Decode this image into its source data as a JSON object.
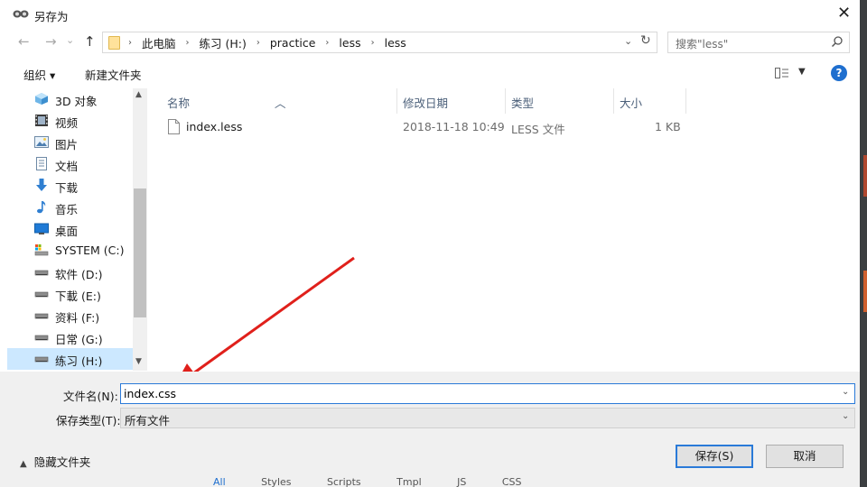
{
  "window": {
    "title": "另存为",
    "close_glyph": "✕"
  },
  "nav": {
    "back_glyph": "←",
    "forward_glyph": "→",
    "dropdown_glyph": "⌄",
    "up_glyph": "↑"
  },
  "address": {
    "crumbs": [
      "此电脑",
      "练习 (H:)",
      "practice",
      "less",
      "less"
    ],
    "separator": "›"
  },
  "search": {
    "placeholder": "搜索\"less\""
  },
  "toolbar": {
    "organize_label": "组织 ▾",
    "new_folder_label": "新建文件夹",
    "help_label": "?"
  },
  "sidebar": {
    "items": [
      {
        "label": "3D 对象",
        "icon": "3d-objects-icon"
      },
      {
        "label": "视频",
        "icon": "video-icon"
      },
      {
        "label": "图片",
        "icon": "pictures-icon"
      },
      {
        "label": "文档",
        "icon": "documents-icon"
      },
      {
        "label": "下载",
        "icon": "download-icon"
      },
      {
        "label": "音乐",
        "icon": "music-icon"
      },
      {
        "label": "桌面",
        "icon": "desktop-icon"
      },
      {
        "label": "SYSTEM (C:)",
        "icon": "system-drive-icon"
      },
      {
        "label": "软件 (D:)",
        "icon": "drive-icon"
      },
      {
        "label": "下載 (E:)",
        "icon": "drive-icon"
      },
      {
        "label": "资料 (F:)",
        "icon": "drive-icon"
      },
      {
        "label": "日常 (G:)",
        "icon": "drive-icon"
      },
      {
        "label": "练习 (H:)",
        "icon": "drive-icon",
        "selected": true
      }
    ]
  },
  "files": {
    "columns": [
      "名称",
      "修改日期",
      "类型",
      "大小"
    ],
    "rows": [
      {
        "name": "index.less",
        "modified": "2018-11-18 10:49",
        "type": "LESS 文件",
        "size": "1 KB"
      }
    ]
  },
  "form": {
    "filename_label": "文件名(N):",
    "filename_value": "index.css",
    "filetype_label": "保存类型(T):",
    "filetype_value": "所有文件",
    "hide_folders_label": "隐藏文件夹",
    "save_label": "保存(S)",
    "cancel_label": "取消"
  },
  "background_tabs": [
    "All",
    "Styles",
    "Scripts",
    "Tmpl",
    "JS",
    "CSS"
  ],
  "colors": {
    "accent": "#2a7ad8",
    "selection": "#cce8ff",
    "arrow": "#e0201b"
  }
}
